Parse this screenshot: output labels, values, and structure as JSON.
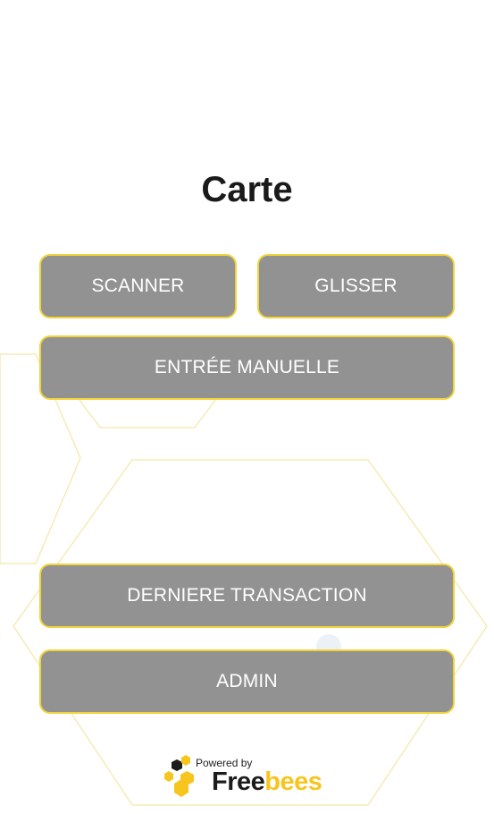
{
  "page": {
    "title": "Carte"
  },
  "buttons": {
    "scanner": "SCANNER",
    "glisser": "GLISSER",
    "manual_entry": "ENTRÉE MANUELLE",
    "last_transaction": "DERNIERE TRANSACTION",
    "admin": "ADMIN"
  },
  "footer": {
    "powered_by": "Powered by",
    "brand_part1": "Free",
    "brand_part2": "bees",
    "logo_icon": "honeycomb-icon"
  },
  "colors": {
    "button_bg": "#929292",
    "button_border": "#f2d33a",
    "brand_yellow": "#f7c51e",
    "brand_dark": "#1c1c1c",
    "title": "#1a1a1a"
  }
}
